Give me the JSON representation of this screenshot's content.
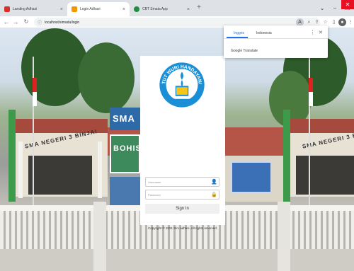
{
  "browser": {
    "tabs": [
      {
        "label": "Landing Adhasi",
        "favicon_color": "#d93025",
        "favicon": "tulip-icon"
      },
      {
        "label": "Login Adhasi",
        "favicon_color": "#f29900",
        "favicon": "page-icon"
      },
      {
        "label": "CBT Smata App",
        "favicon_color": "#1e8e3e",
        "favicon": "app-icon"
      }
    ],
    "new_tab": "+",
    "tab_close": "×",
    "url": "localhost/simadu/login",
    "window": {
      "collapse": "⌄",
      "minimize": "−",
      "maximize": "❐",
      "close": "✕"
    }
  },
  "translate_popup": {
    "lang_selected": "Inggris",
    "lang_other": "Indonesia",
    "brand": "Google Translate",
    "menu": "⋮",
    "close": "✕"
  },
  "login": {
    "logo_text": "TUT WURI HANDAYANI",
    "username_placeholder": "Username",
    "password_placeholder": "Password",
    "signin_label": "Sign In",
    "copyright": "Copyright © 2021 Sim adhasi. All rights reserved."
  },
  "background": {
    "school_name": "SMA NEGERI 3 BINJAI",
    "sign_left": "SMA",
    "sign_mid": "BOHIS"
  },
  "colors": {
    "logo_blue": "#1b8fd6",
    "logo_yellow": "#f5c518",
    "accent": "#1a73e8",
    "close_red": "#e81123"
  }
}
